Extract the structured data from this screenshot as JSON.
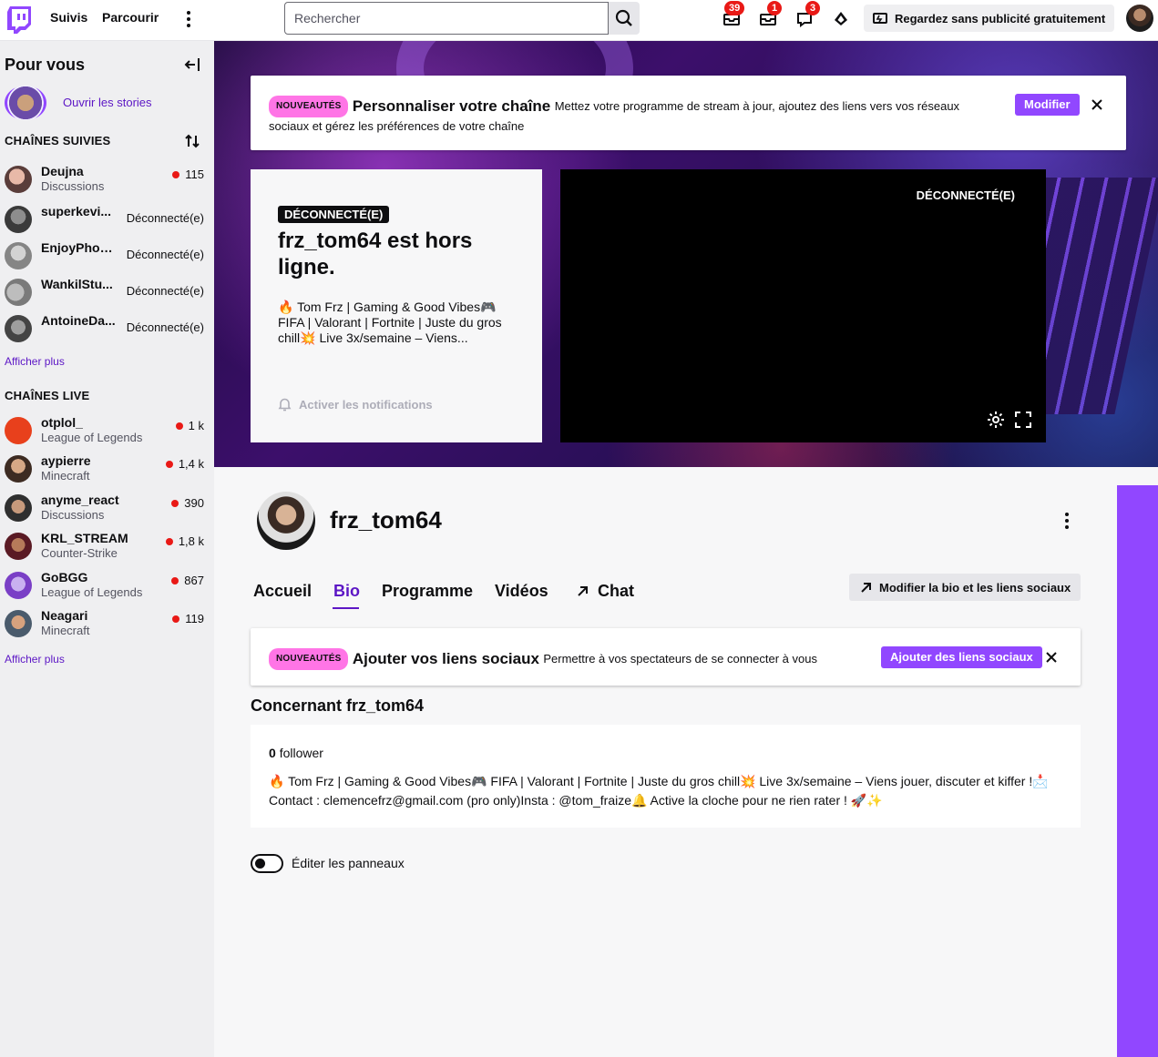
{
  "topnav": {
    "following": "Suivis",
    "browse": "Parcourir",
    "search_placeholder": "Rechercher",
    "badges": {
      "whispers": "39",
      "inbox": "1",
      "notifications": "3"
    },
    "promo": "Regardez sans publicité gratuitement"
  },
  "sidebar": {
    "title": "Pour vous",
    "stories": "Ouvrir les stories",
    "followed_title": "CHAÎNES SUIVIES",
    "followed": [
      {
        "name": "Deujna",
        "category": "Discussions",
        "status": "115",
        "live": true
      },
      {
        "name": "superkevi...",
        "category": "",
        "status": "Déconnecté(e)",
        "live": false
      },
      {
        "name": "EnjoyPhoe...",
        "category": "",
        "status": "Déconnecté(e)",
        "live": false
      },
      {
        "name": "WankilStu...",
        "category": "",
        "status": "Déconnecté(e)",
        "live": false
      },
      {
        "name": "AntoineDa...",
        "category": "",
        "status": "Déconnecté(e)",
        "live": false
      }
    ],
    "show_more_1": "Afficher plus",
    "live_title": "CHAÎNES LIVE",
    "live": [
      {
        "name": "otplol_",
        "category": "League of Legends",
        "status": "1 k"
      },
      {
        "name": "aypierre",
        "category": "Minecraft",
        "status": "1,4 k"
      },
      {
        "name": "anyme_react",
        "category": "Discussions",
        "status": "390"
      },
      {
        "name": "KRL_STREAM",
        "category": "Counter-Strike",
        "status": "1,8 k"
      },
      {
        "name": "GoBGG",
        "category": "League of Legends",
        "status": "867"
      },
      {
        "name": "Neagari",
        "category": "Minecraft",
        "status": "119"
      }
    ],
    "show_more_2": "Afficher plus"
  },
  "banner_notice": {
    "tag": "NOUVEAUTÉS",
    "title": "Personnaliser votre chaîne",
    "text": "Mettez votre programme de stream à jour, ajoutez des liens vers vos réseaux sociaux et gérez les préférences de votre chaîne",
    "button": "Modifier"
  },
  "offline": {
    "tag": "DÉCONNECTÉ(E)",
    "title": "frz_tom64 est hors ligne.",
    "description": "🔥 Tom Frz | Gaming & Good Vibes🎮 FIFA | Valorant | Fortnite | Juste du gros chill💥 Live 3x/semaine – Viens...",
    "notify": "Activer les notifications"
  },
  "player": {
    "status": "DÉCONNECTÉ(E)"
  },
  "profile": {
    "name": "frz_tom64",
    "tabs": [
      "Accueil",
      "Bio",
      "Programme",
      "Vidéos",
      "Chat"
    ],
    "active_tab": "Bio",
    "edit_bio": "Modifier la bio et les liens sociaux"
  },
  "social_notice": {
    "tag": "NOUVEAUTÉS",
    "title": "Ajouter vos liens sociaux",
    "text": "Permettre à vos spectateurs de se connecter à vous",
    "button": "Ajouter des liens sociaux"
  },
  "about": {
    "title": "Concernant frz_tom64",
    "followers_count": "0",
    "followers_label": "follower",
    "bio": "🔥 Tom Frz | Gaming & Good Vibes🎮 FIFA | Valorant | Fortnite | Juste du gros chill💥 Live 3x/semaine – Viens jouer, discuter et kiffer !📩 Contact : clemencefrz@gmail.com (pro only)Insta : @tom_fraize🔔 Active la cloche pour ne rien rater ! 🚀✨"
  },
  "panels_toggle": "Éditer les panneaux",
  "colors": {
    "accent": "#9147ff",
    "accent_text": "#5c16c5",
    "live": "#e91916",
    "new_tag": "#ff75e6"
  }
}
